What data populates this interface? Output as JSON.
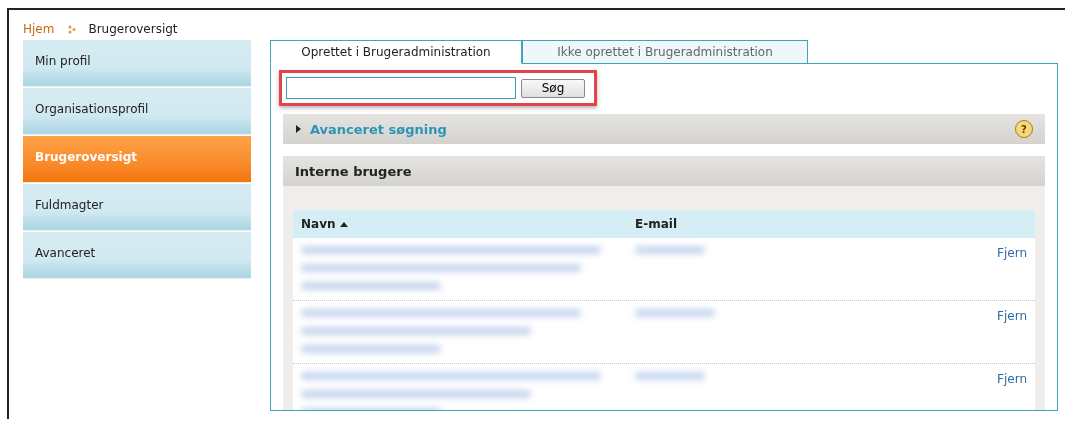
{
  "breadcrumb": [
    {
      "label": "Hjem",
      "kind": "link"
    },
    {
      "label": "Brugeroversigt",
      "kind": "current"
    }
  ],
  "sidebar": {
    "items": [
      {
        "label": "Min profil",
        "selected": false
      },
      {
        "label": "Organisationsprofil",
        "selected": false
      },
      {
        "label": "Brugeroversigt",
        "selected": true
      },
      {
        "label": "Fuldmagter",
        "selected": false
      },
      {
        "label": "Avanceret",
        "selected": false
      }
    ]
  },
  "tabs": [
    {
      "label": "Oprettet i Brugeradministration",
      "selected": true
    },
    {
      "label": "Ikke oprettet i Brugeradministration",
      "selected": false
    }
  ],
  "search": {
    "button": "Søg"
  },
  "advanced_search": {
    "label": "Avanceret søgning",
    "expanded": false,
    "help": "?"
  },
  "section": {
    "title": "Interne brugere"
  },
  "table": {
    "columns": [
      {
        "label": "Navn",
        "sorted": true
      },
      {
        "label": "E-mail",
        "sorted": false
      }
    ],
    "rows": [
      {
        "action": "Fjern"
      },
      {
        "action": "Fjern"
      },
      {
        "action": "Fjern"
      }
    ]
  }
}
